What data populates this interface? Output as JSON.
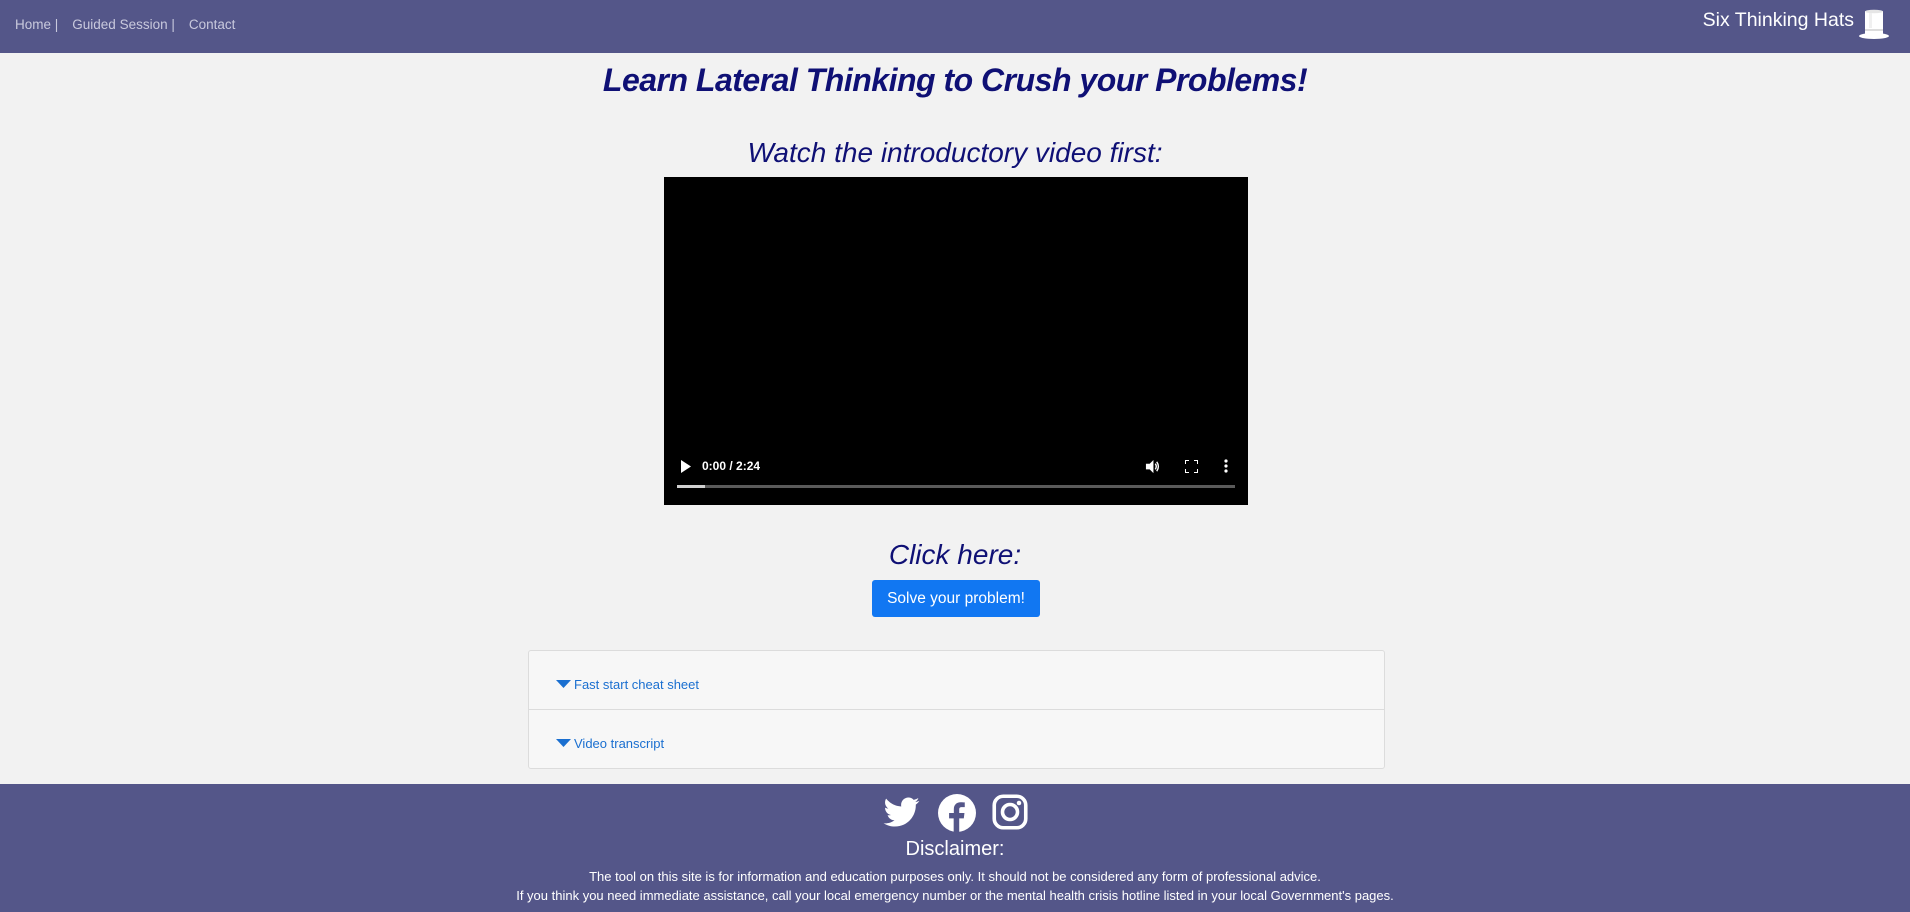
{
  "nav": {
    "home": "Home |",
    "guided": "Guided Session |",
    "contact": "Contact",
    "brand": "Six Thinking Hats"
  },
  "main": {
    "title": "Learn Lateral Thinking to Crush your Problems!",
    "video_heading": "Watch the introductory video first:",
    "video": {
      "time": "0:00 / 2:24",
      "buffered_fraction": 0.05
    },
    "click_here": "Click here:",
    "solve_button": "Solve your problem!"
  },
  "accordion": {
    "items": [
      {
        "label": "Fast start cheat sheet"
      },
      {
        "label": "Video transcript"
      }
    ]
  },
  "footer": {
    "social_icons": [
      "twitter-icon",
      "facebook-icon",
      "instagram-icon"
    ],
    "disclaimer_title": "Disclaimer:",
    "disclaimer_line1": "The tool on this site is for information and education purposes only. It should not be considered any form of professional advice.",
    "disclaimer_line2": "If you think you need immediate assistance, call your local emergency number or the mental health crisis hotline listed in your local Government's pages."
  },
  "colors": {
    "navbar": "#545689",
    "heading": "#0f1075",
    "button": "#1177f2",
    "link": "#1a6fd0"
  }
}
